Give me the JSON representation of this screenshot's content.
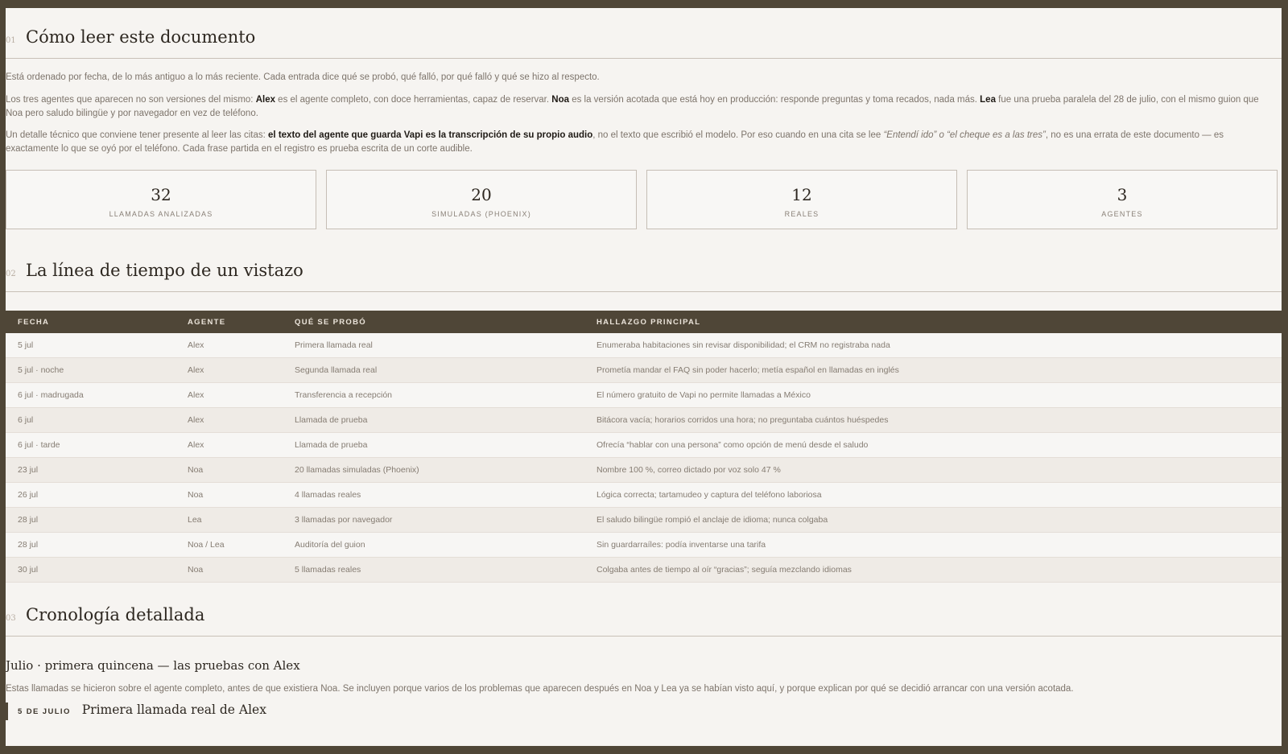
{
  "section1": {
    "num": "01",
    "title": "Cómo leer este documento",
    "p1": "Está ordenado por fecha, de lo más antiguo a lo más reciente. Cada entrada dice qué se probó, qué falló, por qué falló y qué se hizo al respecto.",
    "p2": {
      "t1": "Los tres agentes que aparecen no son versiones del mismo: ",
      "alex": "Alex",
      "t2": " es el agente completo, con doce herramientas, capaz de reservar. ",
      "noa": "Noa",
      "t3": " es la versión acotada que está hoy en producción: responde preguntas y toma recados, nada más. ",
      "lea": "Lea",
      "t4": " fue una prueba paralela del 28 de julio, con el mismo guion que Noa pero saludo bilingüe y por navegador en vez de teléfono."
    },
    "p3": {
      "t1": "Un detalle técnico que conviene tener presente al leer las citas: ",
      "bold": "el texto del agente que guarda Vapi es la transcripción de su propio audio",
      "t2": ", no el texto que escribió el modelo. Por eso cuando en una cita se lee ",
      "italic": "“Entendí ido” o “el cheque es a las tres”",
      "t3": ", no es una errata de este documento — es exactamente lo que se oyó por el teléfono. Cada frase partida en el registro es prueba escrita de un corte audible."
    },
    "stats": [
      {
        "value": "32",
        "label": "LLAMADAS ANALIZADAS"
      },
      {
        "value": "20",
        "label": "SIMULADAS (PHOENIX)"
      },
      {
        "value": "12",
        "label": "REALES"
      },
      {
        "value": "3",
        "label": "AGENTES"
      }
    ]
  },
  "section2": {
    "num": "02",
    "title": "La línea de tiempo de un vistazo",
    "columns": [
      "FECHA",
      "AGENTE",
      "QUÉ SE PROBÓ",
      "HALLAZGO PRINCIPAL"
    ],
    "rows": [
      [
        "5 jul",
        "Alex",
        "Primera llamada real",
        "Enumeraba habitaciones sin revisar disponibilidad; el CRM no registraba nada"
      ],
      [
        "5 jul · noche",
        "Alex",
        "Segunda llamada real",
        "Prometía mandar el FAQ sin poder hacerlo; metía español en llamadas en inglés"
      ],
      [
        "6 jul · madrugada",
        "Alex",
        "Transferencia a recepción",
        "El número gratuito de Vapi no permite llamadas a México"
      ],
      [
        "6 jul",
        "Alex",
        "Llamada de prueba",
        "Bitácora vacía; horarios corridos una hora; no preguntaba cuántos huéspedes"
      ],
      [
        "6 jul · tarde",
        "Alex",
        "Llamada de prueba",
        "Ofrecía “hablar con una persona” como opción de menú desde el saludo"
      ],
      [
        "23 jul",
        "Noa",
        "20 llamadas simuladas (Phoenix)",
        "Nombre 100 %, correo dictado por voz solo 47 %"
      ],
      [
        "26 jul",
        "Noa",
        "4 llamadas reales",
        "Lógica correcta; tartamudeo y captura del teléfono laboriosa"
      ],
      [
        "28 jul",
        "Lea",
        "3 llamadas por navegador",
        "El saludo bilingüe rompió el anclaje de idioma; nunca colgaba"
      ],
      [
        "28 jul",
        "Noa / Lea",
        "Auditoría del guion",
        "Sin guardarraíles: podía inventarse una tarifa"
      ],
      [
        "30 jul",
        "Noa",
        "5 llamadas reales",
        "Colgaba antes de tiempo al oír “gracias”; seguía mezclando idiomas"
      ]
    ]
  },
  "section3": {
    "num": "03",
    "title": "Cronología detallada",
    "subhead": "Julio · primera quincena — las pruebas con Alex",
    "intro": "Estas llamadas se hicieron sobre el agente completo, antes de que existiera Noa. Se incluyen porque varios de los problemas que aparecen después en Noa y Lea ya se habían visto aquí, y porque explican por qué se decidió arrancar con una versión acotada.",
    "entry": {
      "date": "5 DE JULIO",
      "title": "Primera llamada real de Alex"
    }
  }
}
